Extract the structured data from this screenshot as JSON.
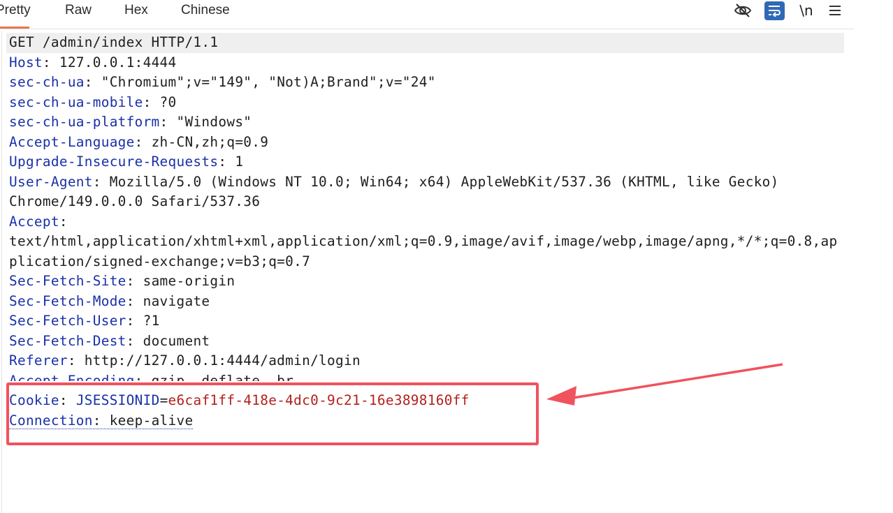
{
  "tabs": [
    {
      "label": "Pretty",
      "active": true
    },
    {
      "label": "Raw",
      "active": false
    },
    {
      "label": "Hex",
      "active": false
    },
    {
      "label": "Chinese",
      "active": false
    }
  ],
  "toolbar": {
    "hide_icon": "eye-off-icon",
    "wrap_icon": "word-wrap-icon",
    "newline_label": "\\n",
    "menu_icon": "menu-icon",
    "accent_color": "#2e6ab5"
  },
  "request": {
    "request_line": "GET /admin/index HTTP/1.1",
    "headers": [
      {
        "name": "Host",
        "value": "127.0.0.1:4444"
      },
      {
        "name": "sec-ch-ua",
        "value": "\"Chromium\";v=\"149\", \"Not)A;Brand\";v=\"24\""
      },
      {
        "name": "sec-ch-ua-mobile",
        "value": "?0"
      },
      {
        "name": "sec-ch-ua-platform",
        "value": "\"Windows\""
      },
      {
        "name": "Accept-Language",
        "value": "zh-CN,zh;q=0.9"
      },
      {
        "name": "Upgrade-Insecure-Requests",
        "value": "1"
      },
      {
        "name": "User-Agent",
        "value": "Mozilla/5.0 (Windows NT 10.0; Win64; x64) AppleWebKit/537.36 (KHTML, like Gecko)"
      },
      {
        "name": "Accept",
        "value": ""
      },
      {
        "name": "Sec-Fetch-Site",
        "value": "same-origin"
      },
      {
        "name": "Sec-Fetch-Mode",
        "value": "navigate"
      },
      {
        "name": "Sec-Fetch-User",
        "value": "?1"
      },
      {
        "name": "Sec-Fetch-Dest",
        "value": "document"
      },
      {
        "name": "Referer",
        "value": "http://127.0.0.1:4444/admin/login"
      },
      {
        "name": "Accept-Encoding",
        "value": "gzip, deflate, br"
      },
      {
        "name": "Connection",
        "value": "keep-alive"
      }
    ],
    "user_agent_cont": "Chrome/149.0.0.0 Safari/537.36",
    "accept_line1": "text/html,application/xhtml+xml,application/xml;q=0.9,image/avif,image/webp,image/apng,*/*;q=0.8,ap",
    "accept_line2": "plication/signed-exchange;v=b3;q=0.7",
    "cookie": {
      "header": "Cookie",
      "name": "JSESSIONID",
      "value": "e6caf1ff-418e-4dc0-9c21-16e3898160ff"
    },
    "sep": ": ",
    "eq": "="
  },
  "annotation": {
    "box_color": "#f0525e"
  }
}
